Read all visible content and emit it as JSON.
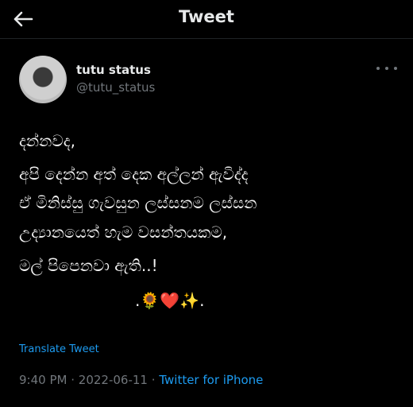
{
  "header": {
    "title": "Tweet",
    "back_icon": "arrow-left-icon"
  },
  "author": {
    "name": "tutu status",
    "handle": "@tutu_status"
  },
  "tweet": {
    "lines": [
      "දන්නවද,",
      "අපි දෙන්න අත් දෙක අල්ලන් ඇවිද්ද",
      "ඒ මිනිස්සු ගැවසුන ලස්සනම ලස්සන",
      "උද්‍යානයෙත් හැම  වසන්තයකම,",
      "මල් පිපෙනවා ඇති..!"
    ],
    "emoji_line": ".🌻❤️✨."
  },
  "translate_label": "Translate Tweet",
  "meta": {
    "time": "9:40 PM",
    "separator": "·",
    "date": "2022-06-11",
    "source": "Twitter for iPhone"
  },
  "colors": {
    "background": "#000000",
    "text": "#e7e9ea",
    "muted": "#71767b",
    "link": "#1d9bf0"
  }
}
